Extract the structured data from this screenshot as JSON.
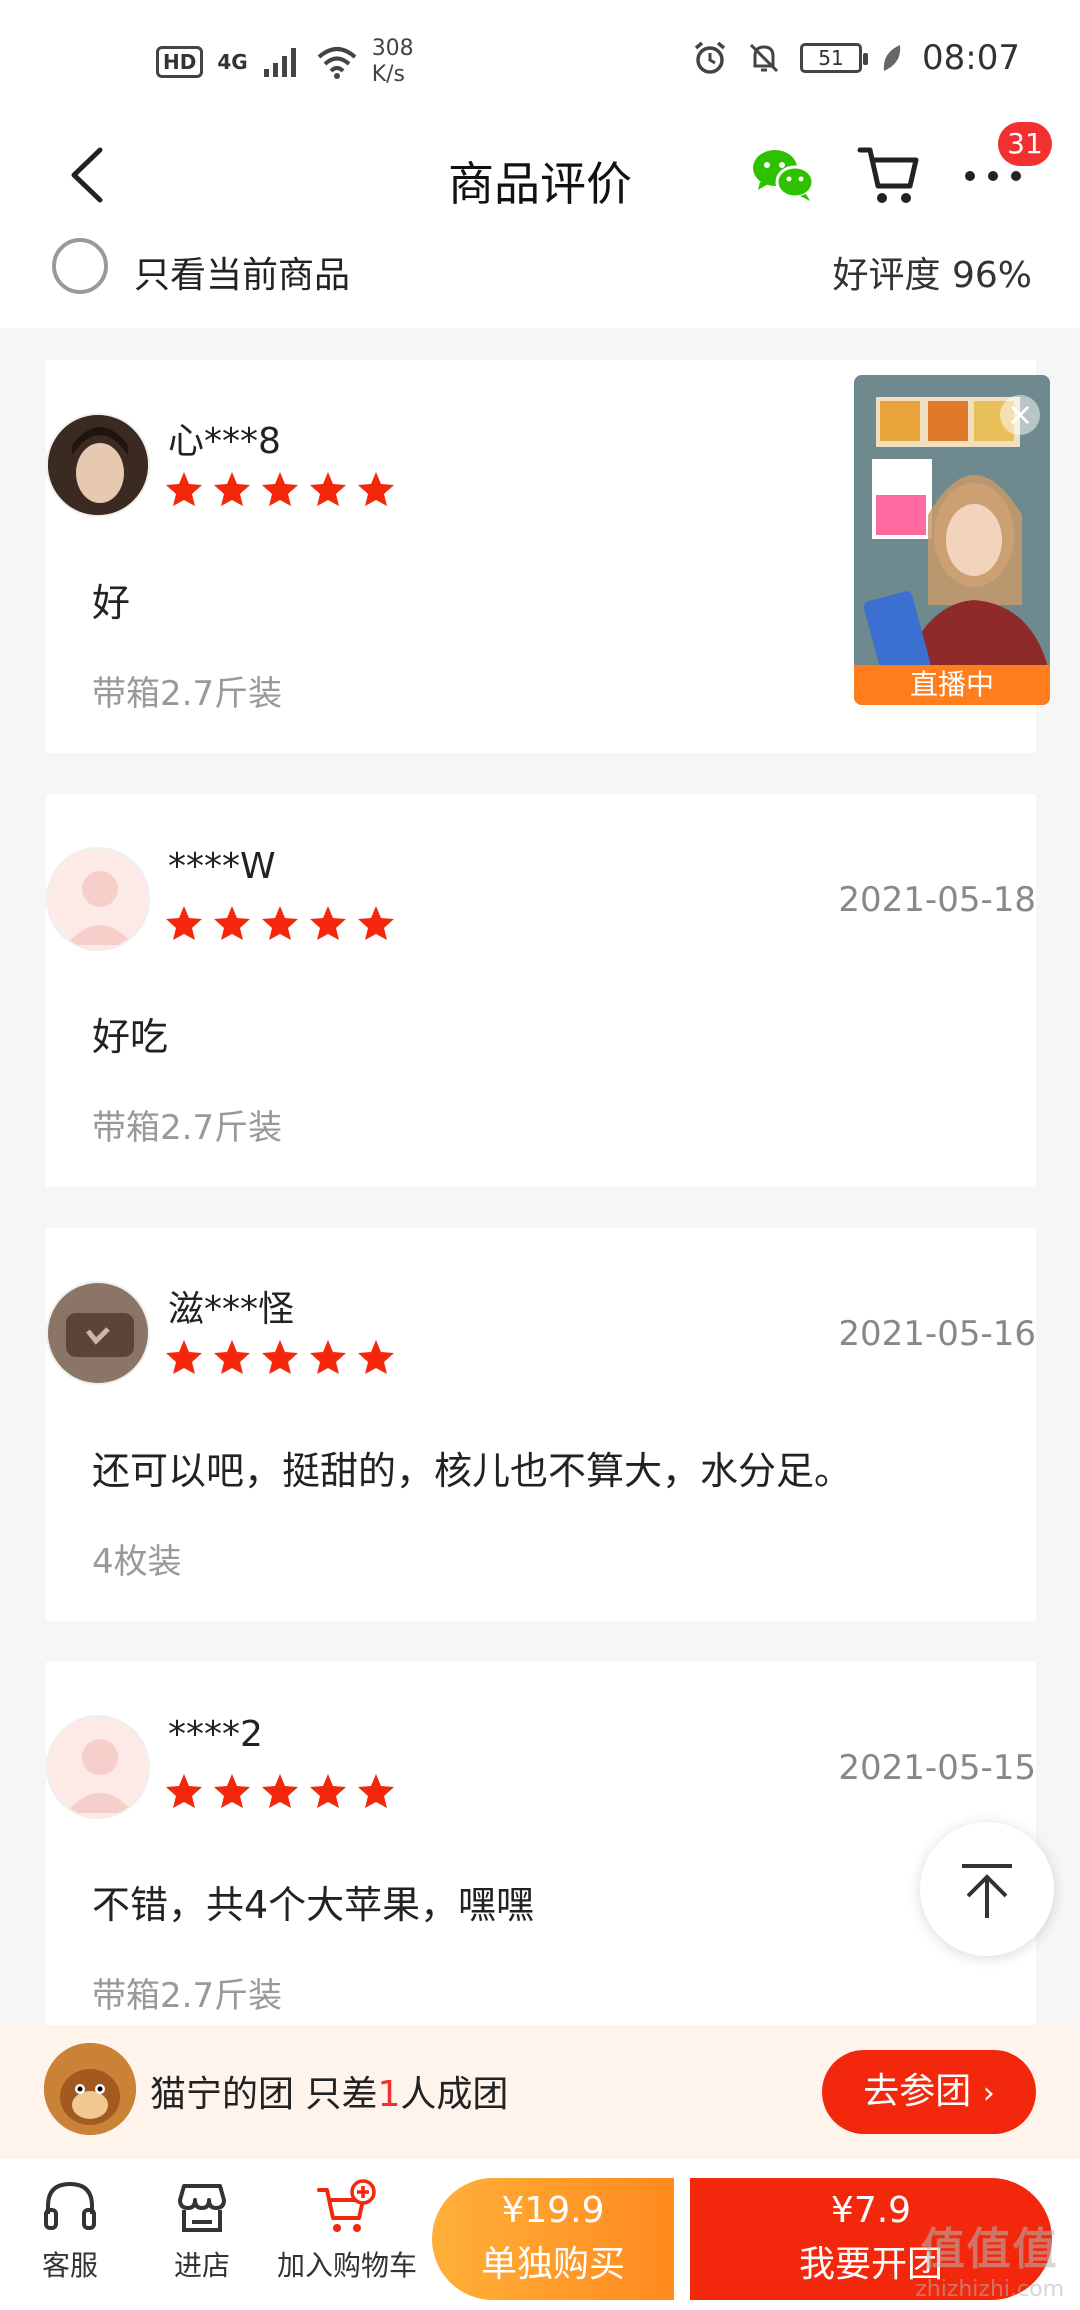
{
  "status_bar": {
    "hd": "HD",
    "network": "4G",
    "speed_value": "308",
    "speed_unit": "K/s",
    "battery": "51",
    "time": "08:07"
  },
  "header": {
    "title": "商品评价",
    "cart_badge": "31"
  },
  "filter": {
    "only_current_label": "只看当前商品",
    "good_rate": "好评度 96%"
  },
  "reviews": [
    {
      "user": "心***8",
      "stars": 5,
      "date": "",
      "text": "好",
      "spec": "带箱2.7斤装"
    },
    {
      "user": "****W",
      "stars": 5,
      "date": "2021-05-18",
      "text": "好吃",
      "spec": "带箱2.7斤装"
    },
    {
      "user": "滋***怪",
      "stars": 5,
      "date": "2021-05-16",
      "text": "还可以吧，挺甜的，核儿也不算大，水分足。",
      "spec": "4枚装"
    },
    {
      "user": "****2",
      "stars": 5,
      "date": "2021-05-15",
      "text": "不错，共4个大苹果，嘿嘿",
      "spec": "带箱2.7斤装"
    }
  ],
  "live": {
    "label": "直播中"
  },
  "group_bar": {
    "team_name": "猫宁的团 只差",
    "count": "1",
    "suffix": "人成团",
    "join_label": "去参团"
  },
  "bottom_bar": {
    "service_label": "客服",
    "store_label": "进店",
    "add_cart_label": "加入购物车",
    "single_price": "¥19.9",
    "single_label": "单独购买",
    "group_price": "¥7.9",
    "group_label": "我要开团"
  },
  "watermark": {
    "big": "值值值",
    "small": "zhizhizhi.com"
  },
  "colors": {
    "accent": "#f2270c",
    "star": "#f2270c",
    "single_buy": "#ffa02e",
    "live_label": "#ff7d1c"
  }
}
